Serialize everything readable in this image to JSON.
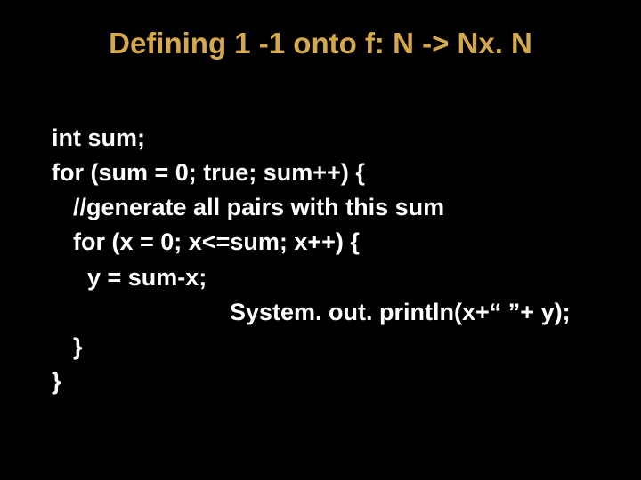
{
  "title": "Defining 1 -1 onto f: N -> Nx. N",
  "code": {
    "l1": "int sum;",
    "l2": "for (sum = 0; true; sum++) {",
    "l3": "//generate all pairs with this sum",
    "l4": "for (x = 0; x<=sum; x++) {",
    "l5": "y = sum-x;",
    "l6": "System. out. println(x+“ ”+ y);",
    "l7": "}",
    "l8": "}"
  }
}
